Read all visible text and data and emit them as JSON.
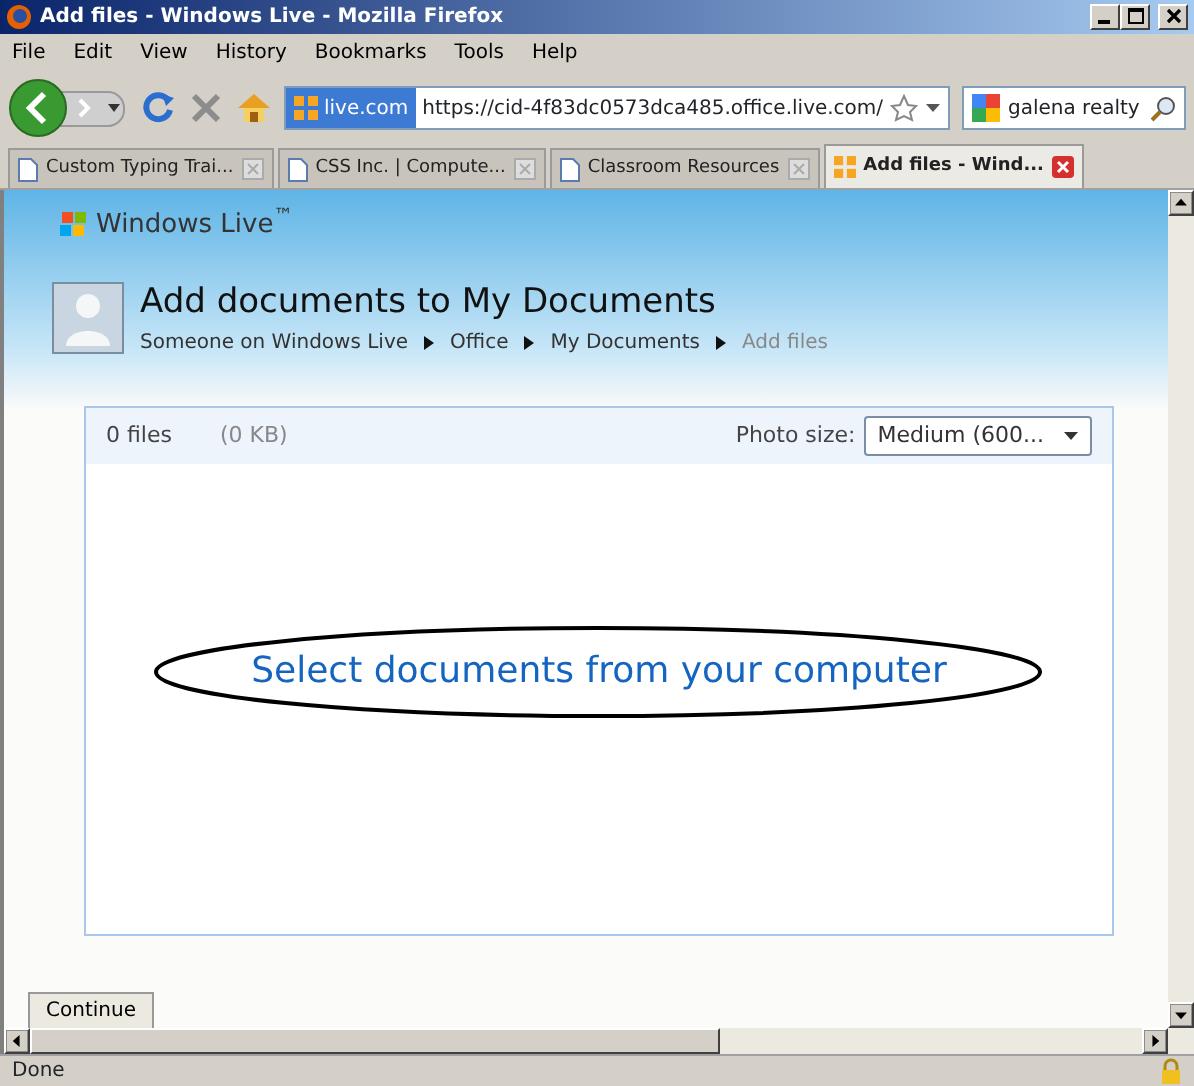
{
  "window": {
    "title": "Add files - Windows Live - Mozilla Firefox"
  },
  "menu": [
    "File",
    "Edit",
    "View",
    "History",
    "Bookmarks",
    "Tools",
    "Help"
  ],
  "toolbar": {
    "site_badge": "live.com",
    "url": "https://cid-4f83dc0573dca485.office.live.com/",
    "search_value": "galena realty"
  },
  "tabs": [
    {
      "label": "Custom Typing Trai...",
      "selected": false
    },
    {
      "label": "CSS Inc. | Compute...",
      "selected": false
    },
    {
      "label": "Classroom Resources",
      "selected": false
    },
    {
      "label": "Add files - Wind...",
      "selected": true
    }
  ],
  "page": {
    "brand": "Windows Live$^{™}$",
    "heading": "Add documents to My Documents",
    "breadcrumb": [
      {
        "label": "Someone on Windows Live",
        "current": false
      },
      {
        "label": "Office",
        "current": false
      },
      {
        "label": "My Documents",
        "current": false
      },
      {
        "label": "Add files",
        "current": true
      }
    ],
    "file_count": "0 files",
    "file_size": "(0 KB)",
    "photo_size_label": "Photo size:",
    "photo_size_value": "Medium (600...",
    "select_link": "Select documents from your computer",
    "continue_button": "Continue"
  },
  "status_bar": "Done"
}
